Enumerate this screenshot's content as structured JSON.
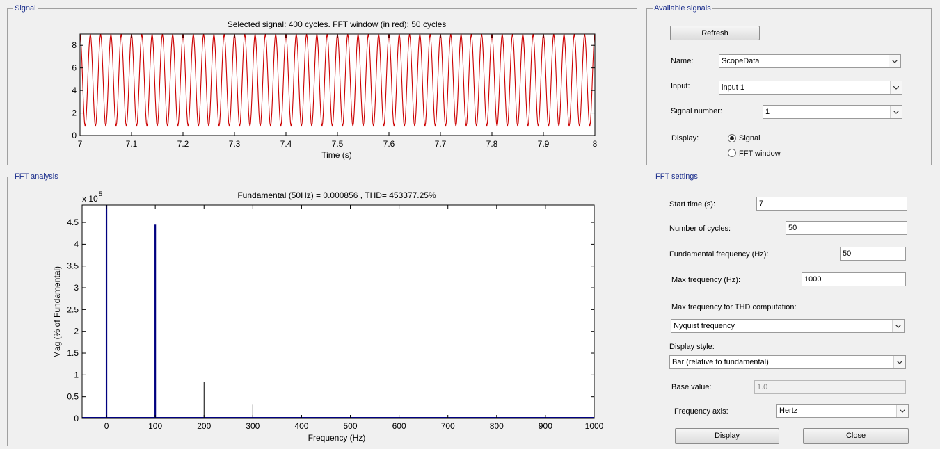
{
  "signal_panel": {
    "title": "Signal",
    "plot_title": "Selected signal: 400 cycles. FFT window (in red): 50 cycles",
    "xlabel": "Time (s)"
  },
  "fft_panel": {
    "title": "FFT analysis",
    "plot_title": "Fundamental (50Hz) = 0.000856 , THD= 453377.25%",
    "xlabel": "Frequency (Hz)",
    "ylabel": "Mag (% of Fundamental)",
    "exponent_base": "x 10",
    "exponent_power": "5"
  },
  "available_signals": {
    "title": "Available signals",
    "refresh_label": "Refresh",
    "name_label": "Name:",
    "name_value": "ScopeData",
    "input_label": "Input:",
    "input_value": "input 1",
    "signal_number_label": "Signal number:",
    "signal_number_value": "1",
    "display_label": "Display:",
    "display_options": [
      "Signal",
      "FFT window"
    ],
    "display_selected": "Signal"
  },
  "fft_settings": {
    "title": "FFT settings",
    "start_time_label": "Start time (s):",
    "start_time_value": "7",
    "num_cycles_label": "Number of cycles:",
    "num_cycles_value": "50",
    "fund_freq_label": "Fundamental frequency (Hz):",
    "fund_freq_value": "50",
    "max_freq_label": "Max frequency (Hz):",
    "max_freq_value": "1000",
    "thd_label": "Max frequency for THD computation:",
    "thd_value": "Nyquist frequency",
    "display_style_label": "Display style:",
    "display_style_value": "Bar (relative to fundamental)",
    "base_value_label": "Base value:",
    "base_value_value": "1.0",
    "freq_axis_label": "Frequency axis:",
    "freq_axis_value": "Hertz",
    "display_button": "Display",
    "close_button": "Close"
  },
  "colors": {
    "signal_line": "#cc0000",
    "fft_window": "#e00000",
    "bar": "#000080",
    "group_title": "#1a2d8c"
  },
  "chart_data": [
    {
      "type": "line",
      "title": "Selected signal: 400 cycles. FFT window (in red): 50 cycles",
      "xlabel": "Time (s)",
      "ylabel": "",
      "xlim": [
        7,
        8
      ],
      "ylim": [
        0,
        9
      ],
      "xticks": [
        "7",
        "7.1",
        "7.2",
        "7.3",
        "7.4",
        "7.5",
        "7.6",
        "7.7",
        "7.8",
        "7.9",
        "8"
      ],
      "yticks": [
        "0",
        "2",
        "4",
        "6",
        "8"
      ],
      "series": [
        {
          "frequency_hz": 50,
          "min": 0.8,
          "max": 9,
          "cycles_shown": 50
        }
      ],
      "grid": false
    },
    {
      "type": "bar",
      "title": "Fundamental (50Hz) = 0.000856 , THD= 453377.25%",
      "xlabel": "Frequency (Hz)",
      "ylabel": "Mag (% of Fundamental)",
      "y_multiplier": "x 10^5",
      "xlim": [
        -50,
        1000
      ],
      "ylim": [
        0,
        4.9
      ],
      "xticks": [
        "0",
        "100",
        "200",
        "300",
        "400",
        "500",
        "600",
        "700",
        "800",
        "900",
        "1000"
      ],
      "yticks": [
        "0",
        "0.5",
        "1",
        "1.5",
        "2",
        "2.5",
        "3",
        "3.5",
        "4",
        "4.5"
      ],
      "x": [
        0,
        100,
        200,
        300
      ],
      "values": [
        4.9,
        4.45,
        0.83,
        0.33
      ],
      "bar_weights": [
        "heavy",
        "heavy",
        "thin",
        "thin"
      ],
      "grid": false
    }
  ]
}
